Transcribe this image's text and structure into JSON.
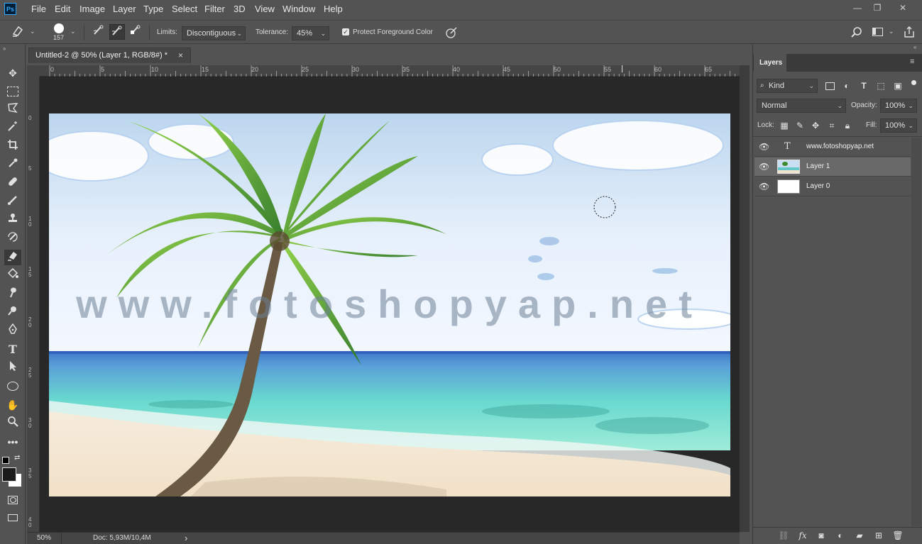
{
  "app": {
    "logo": "Ps"
  },
  "menu": [
    "File",
    "Edit",
    "Image",
    "Layer",
    "Type",
    "Select",
    "Filter",
    "3D",
    "View",
    "Window",
    "Help"
  ],
  "window_controls": {
    "minimize": "—",
    "restore": "❐",
    "close": "✕"
  },
  "options": {
    "brush_size": "157",
    "limits_label": "Limits:",
    "limits_value": "Discontiguous",
    "tolerance_label": "Tolerance:",
    "tolerance_value": "45%",
    "protect_fg_label": "Protect Foreground Color",
    "protect_fg_checked": true
  },
  "document": {
    "tab_title": "Untitled-2 @ 50% (Layer 1, RGB/8#) *",
    "tab_close": "×",
    "watermark": "www.fotoshopyap.net",
    "ruler_h": [
      "0",
      "5",
      "10",
      "15",
      "20",
      "25",
      "30",
      "35",
      "40",
      "45",
      "50",
      "55",
      "60",
      "65"
    ],
    "ruler_v": [
      "0",
      "5",
      "1 0",
      "1 5",
      "2 0",
      "2 5",
      "3 0",
      "3 5",
      "4 0"
    ]
  },
  "status": {
    "zoom": "50%",
    "doc": "Doc: 5,93M/10,4M",
    "arrow": "›"
  },
  "layers_panel": {
    "tab": "Layers",
    "filter_kind": "Kind",
    "blend_mode": "Normal",
    "opacity_label": "Opacity:",
    "opacity_value": "100%",
    "lock_label": "Lock:",
    "fill_label": "Fill:",
    "fill_value": "100%",
    "layers": [
      {
        "name": "www.fotoshopyap.net",
        "type": "text",
        "visible": true,
        "selected": false
      },
      {
        "name": "Layer 1",
        "type": "image",
        "visible": true,
        "selected": true
      },
      {
        "name": "Layer 0",
        "type": "fill",
        "visible": true,
        "selected": false
      }
    ]
  },
  "colors": {
    "ui_bg": "#535353",
    "panel_dark": "#454545",
    "pasteboard": "#282828",
    "accent_ps": "#31a8ff",
    "selected_layer": "#696969"
  }
}
